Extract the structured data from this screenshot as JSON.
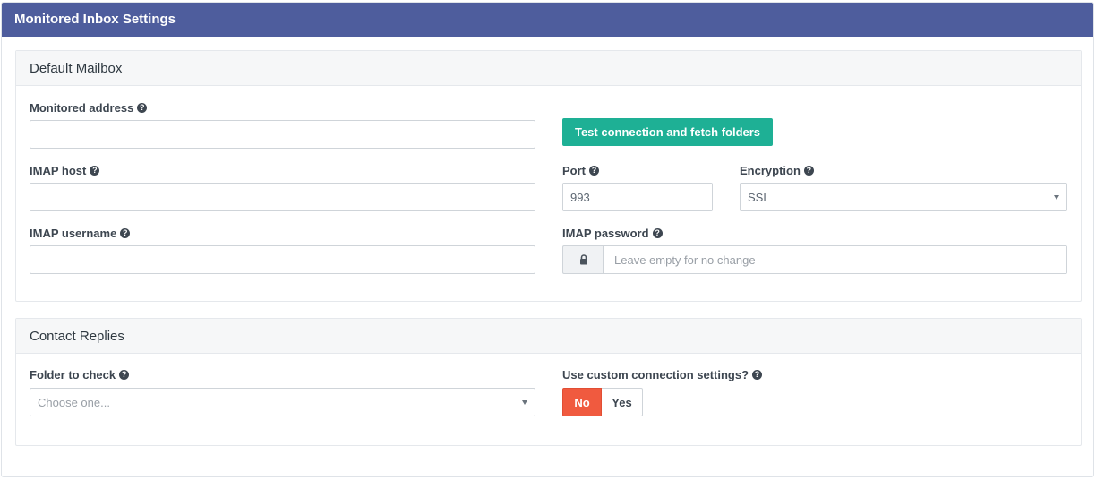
{
  "panel": {
    "title": "Monitored Inbox Settings"
  },
  "default_mailbox": {
    "title": "Default Mailbox",
    "monitored_address": {
      "label": "Monitored address",
      "value": ""
    },
    "test_button": "Test connection and fetch folders",
    "imap_host": {
      "label": "IMAP host",
      "value": ""
    },
    "port": {
      "label": "Port",
      "value": "993"
    },
    "encryption": {
      "label": "Encryption",
      "value": "SSL"
    },
    "imap_username": {
      "label": "IMAP username",
      "value": ""
    },
    "imap_password": {
      "label": "IMAP password",
      "placeholder": "Leave empty for no change"
    }
  },
  "contact_replies": {
    "title": "Contact Replies",
    "folder": {
      "label": "Folder to check",
      "placeholder": "Choose one..."
    },
    "custom_connection": {
      "label": "Use custom connection settings?",
      "options": [
        "No",
        "Yes"
      ],
      "selected": "No"
    }
  },
  "colors": {
    "header": "#4e5d9d",
    "teal_button": "#1eb095",
    "toggle_active": "#f05a3f"
  },
  "icons": {
    "help": "question-circle-icon",
    "lock": "lock-icon",
    "caret": "chevron-down-icon"
  }
}
